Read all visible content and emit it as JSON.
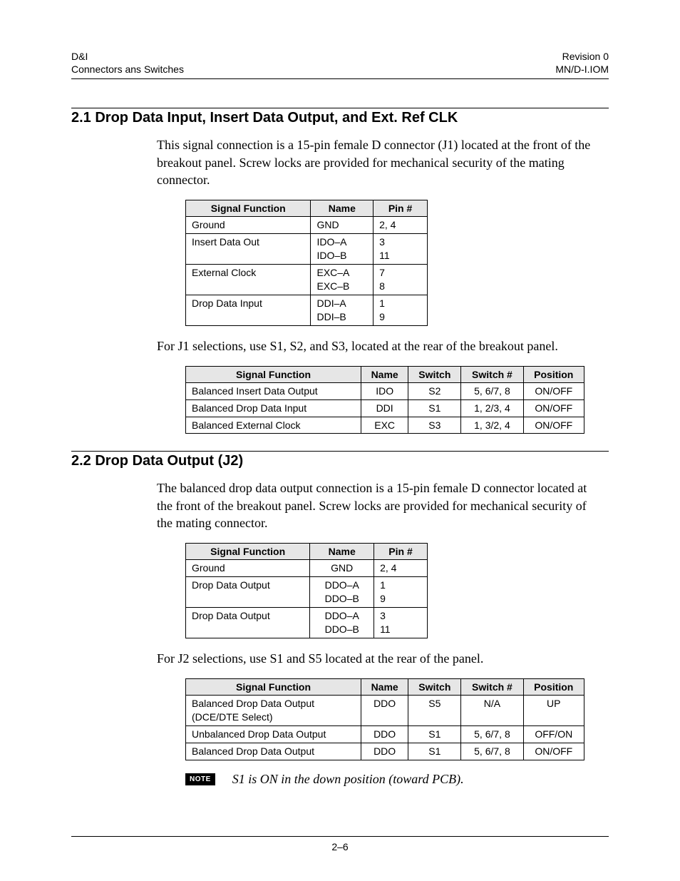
{
  "header": {
    "left_line1": "D&I",
    "left_line2": "Connectors ans Switches",
    "right_line1": "Revision 0",
    "right_line2": "MN/D-I.IOM"
  },
  "section1": {
    "heading": "2.1  Drop Data Input, Insert Data Output, and Ext. Ref CLK",
    "para": "This signal connection is a 15-pin female D connector (J1) located at the front of the breakout panel. Screw locks are provided for mechanical security of the mating connector.",
    "table1": {
      "headers": [
        "Signal Function",
        "Name",
        "Pin #"
      ],
      "rows": [
        {
          "func": "Ground",
          "name": "GND",
          "pin": "2, 4"
        },
        {
          "func": "Insert Data Out",
          "name": "IDO–A\nIDO–B",
          "pin": "3\n11"
        },
        {
          "func": "External Clock",
          "name": "EXC–A\nEXC–B",
          "pin": "7\n8"
        },
        {
          "func": "Drop Data Input",
          "name": "DDI–A\nDDI–B",
          "pin": "1\n9"
        }
      ]
    },
    "mid_para": "For J1 selections, use S1, S2, and S3, located at the rear of the breakout panel.",
    "table2": {
      "headers": [
        "Signal Function",
        "Name",
        "Switch",
        "Switch #",
        "Position"
      ],
      "rows": [
        {
          "func": "Balanced Insert Data Output",
          "name": "IDO",
          "sw": "S2",
          "num": "5, 6/7, 8",
          "pos": "ON/OFF"
        },
        {
          "func": "Balanced Drop Data Input",
          "name": "DDI",
          "sw": "S1",
          "num": "1, 2/3, 4",
          "pos": "ON/OFF"
        },
        {
          "func": "Balanced External Clock",
          "name": "EXC",
          "sw": "S3",
          "num": "1, 3/2, 4",
          "pos": "ON/OFF"
        }
      ]
    }
  },
  "section2": {
    "heading": "2.2  Drop Data Output (J2)",
    "para": "The balanced drop data output connection is a 15-pin female D connector located at the front of the breakout panel. Screw locks are provided for mechanical security of the mating connector.",
    "table1": {
      "headers": [
        "Signal Function",
        "Name",
        "Pin #"
      ],
      "rows": [
        {
          "func": "Ground",
          "name": "GND",
          "pin": "2, 4"
        },
        {
          "func": "Drop Data Output",
          "name": "DDO–A\nDDO–B",
          "pin": "1\n9"
        },
        {
          "func": "Drop Data Output",
          "name": "DDO–A\nDDO–B",
          "pin": "3\n11"
        }
      ]
    },
    "mid_para": "For J2 selections, use S1 and S5 located at the rear of the panel.",
    "table2": {
      "headers": [
        "Signal Function",
        "Name",
        "Switch",
        "Switch #",
        "Position"
      ],
      "rows": [
        {
          "func": "Balanced Drop Data Output\n(DCE/DTE Select)",
          "name": "DDO",
          "sw": "S5",
          "num": "N/A",
          "pos": "UP"
        },
        {
          "func": "Unbalanced Drop Data Output",
          "name": "DDO",
          "sw": "S1",
          "num": "5, 6/7, 8",
          "pos": "OFF/ON"
        },
        {
          "func": "Balanced Drop Data Output",
          "name": "DDO",
          "sw": "S1",
          "num": "5, 6/7, 8",
          "pos": "ON/OFF"
        }
      ]
    },
    "note_label": "NOTE",
    "note_text": "S1 is ON in the down position (toward PCB)."
  },
  "footer": "2–6"
}
